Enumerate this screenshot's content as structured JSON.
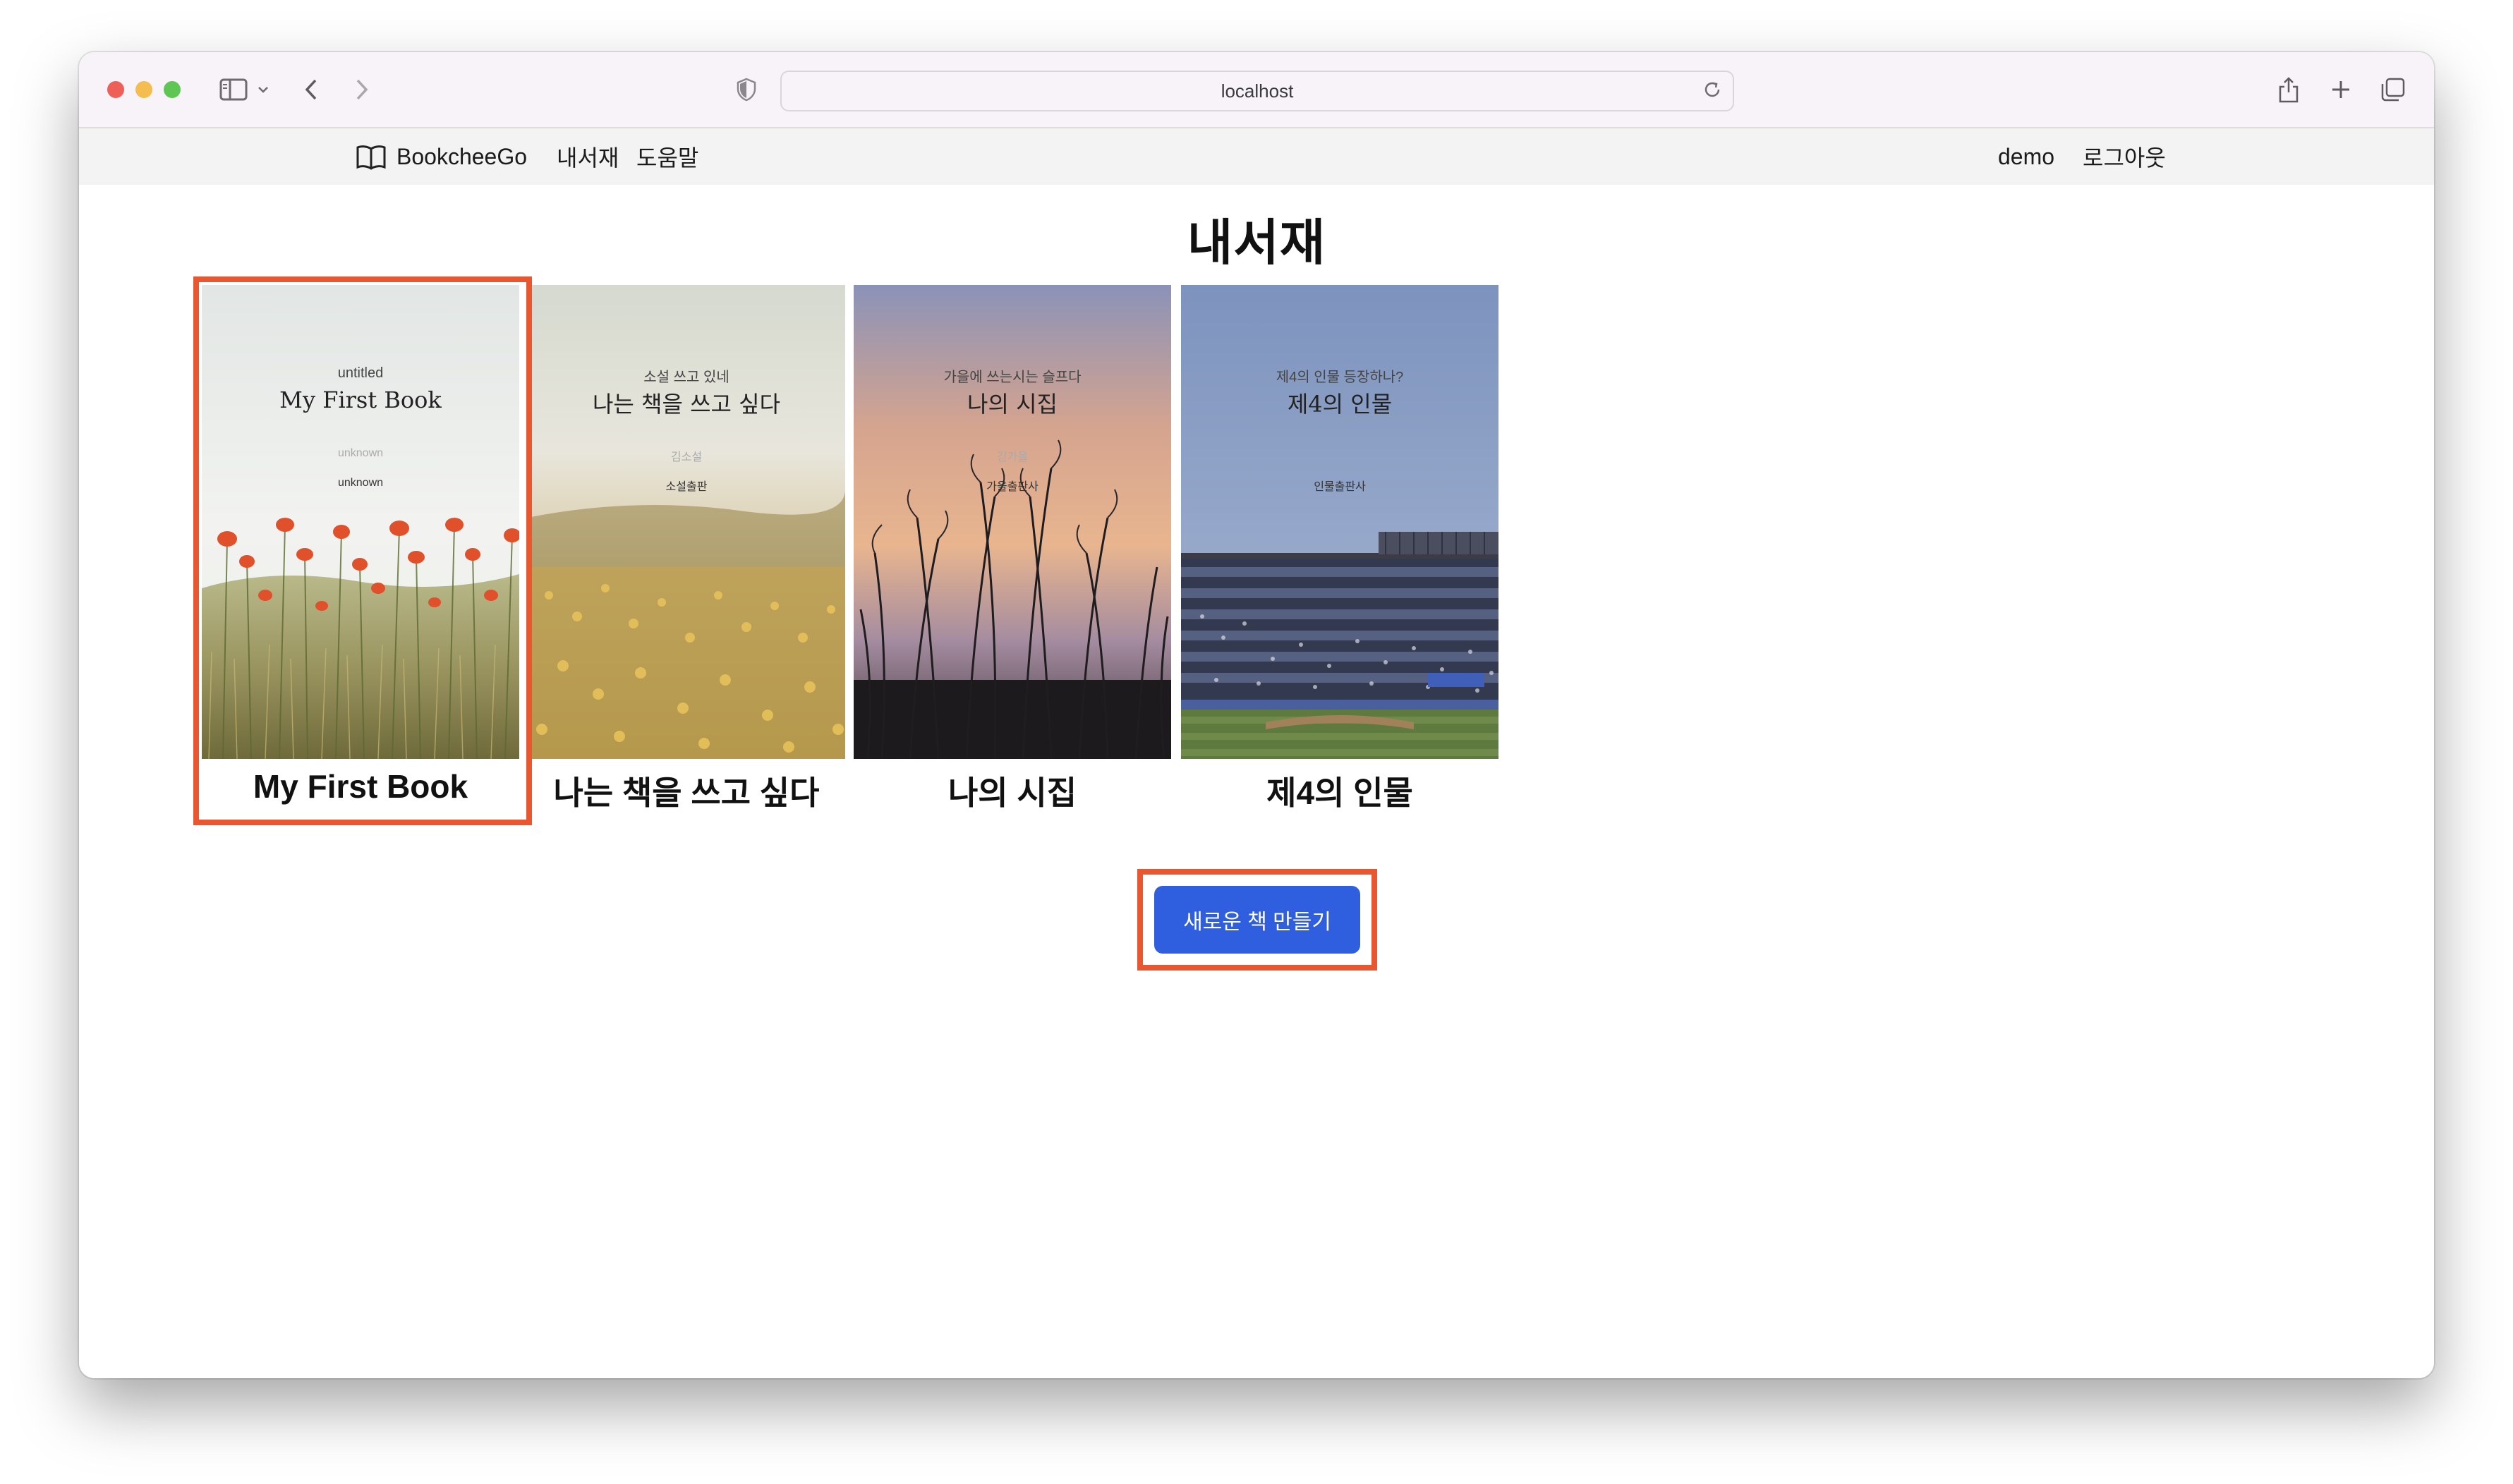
{
  "browser": {
    "url": "localhost"
  },
  "navbar": {
    "brand": "BookcheeGo",
    "links": [
      "내서재",
      "도움말"
    ],
    "user": "demo",
    "logout": "로그아웃"
  },
  "page": {
    "title": "내서재"
  },
  "books": [
    {
      "cover_subtitle": "untitled",
      "cover_title": "My First Book",
      "cover_author": "unknown",
      "cover_publisher": "unknown",
      "title": "My First Book",
      "cover_theme": "poppy-field",
      "selected": true
    },
    {
      "cover_subtitle": "소설 쓰고 있네",
      "cover_title": "나는 책을 쓰고 싶다",
      "cover_author": "김소설",
      "cover_publisher": "소설출판",
      "title": "나는 책을 쓰고 싶다",
      "cover_theme": "yellow-flower-field",
      "selected": false
    },
    {
      "cover_subtitle": "가을에 쓰는시는 슬프다",
      "cover_title": "나의 시집",
      "cover_author": "김가을",
      "cover_publisher": "가을출판사",
      "title": "나의 시집",
      "cover_theme": "silver-grass-sunset",
      "selected": false
    },
    {
      "cover_subtitle": "제4의 인물 등장하나?",
      "cover_title": "제4의 인물",
      "cover_author": "",
      "cover_publisher": "인물출판사",
      "title": "제4의 인물",
      "cover_theme": "baseball-stadium",
      "selected": false
    }
  ],
  "actions": {
    "new_book": "새로운 책 만들기"
  },
  "colors": {
    "highlight": "#e8572f",
    "button": "#2f5fde"
  }
}
